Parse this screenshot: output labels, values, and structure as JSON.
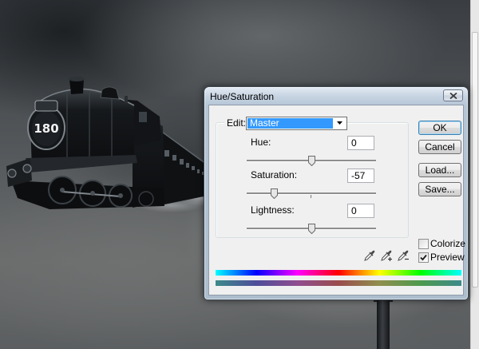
{
  "scene": {
    "locomotive_number": "180"
  },
  "dialog": {
    "title": "Hue/Saturation",
    "close_icon": "close-icon",
    "edit": {
      "label": "Edit:",
      "value": "Master",
      "arrow_icon": "dropdown-arrow-icon"
    },
    "hue": {
      "label": "Hue:",
      "value": "0"
    },
    "saturation": {
      "label": "Saturation:",
      "value": "-57"
    },
    "lightness": {
      "label": "Lightness:",
      "value": "0"
    },
    "buttons": {
      "ok": "OK",
      "cancel": "Cancel",
      "load": "Load...",
      "save": "Save..."
    },
    "eyedropper_icons": [
      "eyedropper-icon",
      "eyedropper-plus-icon",
      "eyedropper-minus-icon"
    ],
    "colorize": {
      "label": "Colorize",
      "checked": false
    },
    "preview": {
      "label": "Preview",
      "checked": true
    },
    "color_bars": {
      "input_spectrum": [
        "#00ffff",
        "#0000ff",
        "#ff00ff",
        "#ff0000",
        "#ffff00",
        "#00ff00",
        "#00ffff"
      ],
      "output_spectrum": [
        "#3d8a8a",
        "#4d4d9a",
        "#8f4d8f",
        "#9a4d4d",
        "#8f8f4d",
        "#4d9a4d",
        "#3d8a8a"
      ]
    },
    "colors": {
      "selection": "#3399ff",
      "default_button_border": "#3c7fb1",
      "client_background": "#f0f0f0"
    }
  }
}
